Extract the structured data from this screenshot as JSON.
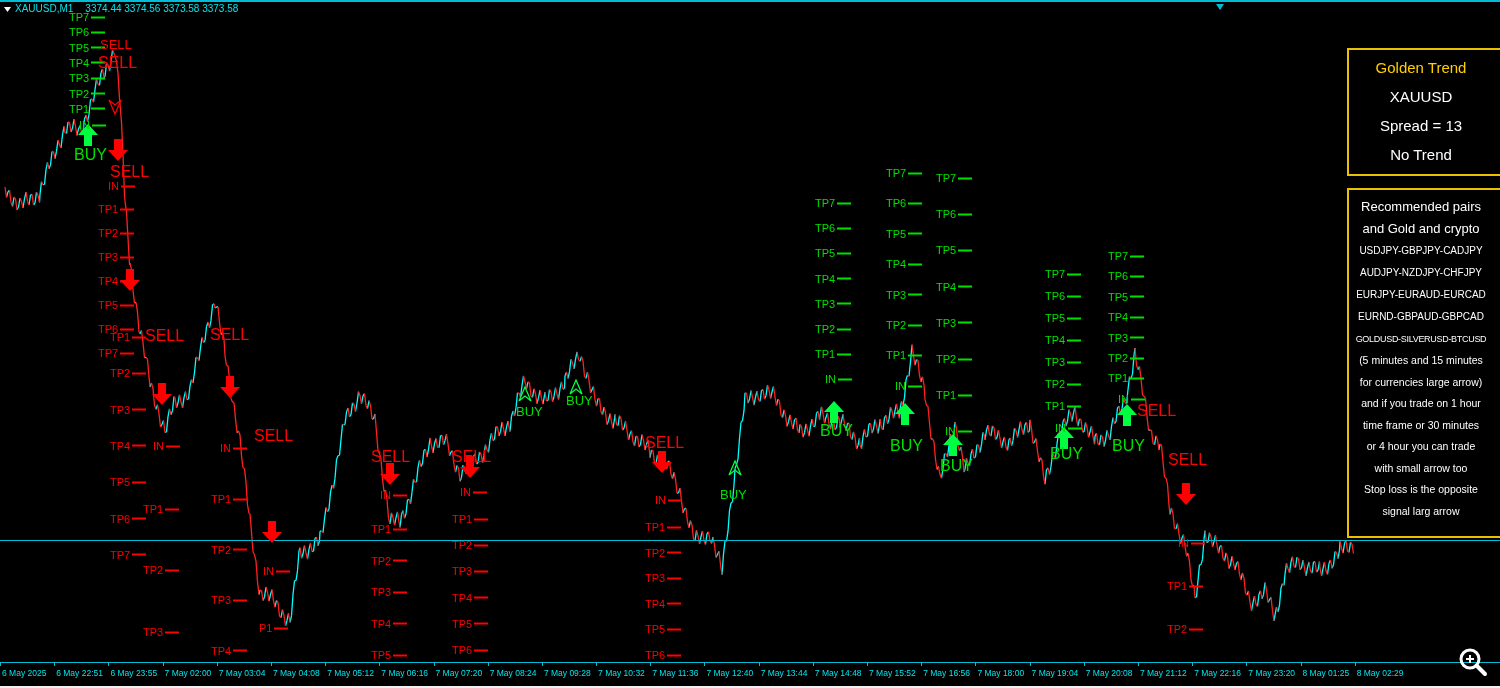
{
  "chart": {
    "symbol": "XAUUSD,M1",
    "prices": "3374.44 3374.56 3373.58 3373.58"
  },
  "labels": [
    {
      "kind": "level",
      "buy": true,
      "text": "TP7"
    },
    {
      "kind": "level",
      "buy": true,
      "text": "TP6"
    },
    {
      "kind": "level",
      "buy": true,
      "text": "TP5"
    },
    {
      "kind": "level",
      "buy": true,
      "text": "TP4"
    },
    {
      "kind": "level",
      "buy": true,
      "text": "TP3"
    },
    {
      "kind": "level",
      "buy": true,
      "text": "TP2"
    },
    {
      "kind": "level",
      "buy": true,
      "text": "TP1"
    },
    {
      "kind": "level",
      "buy": true,
      "text": "IN"
    },
    {
      "kind": "large",
      "buy": true,
      "text": "BUY"
    },
    {
      "kind": "small",
      "buy": false,
      "text": "SELL"
    },
    {
      "kind": "large",
      "buy": false,
      "text": "SELL"
    },
    {
      "kind": "large",
      "buy": false,
      "text": "SELL"
    },
    {
      "kind": "level",
      "buy": false,
      "text": "IN"
    },
    {
      "kind": "level",
      "buy": false,
      "text": "TP1"
    },
    {
      "kind": "level",
      "buy": false,
      "text": "TP2"
    },
    {
      "kind": "level",
      "buy": false,
      "text": "TP3"
    },
    {
      "kind": "level",
      "buy": false,
      "text": "TP4"
    },
    {
      "kind": "level",
      "buy": false,
      "text": "TP5"
    },
    {
      "kind": "level",
      "buy": false,
      "text": "TP6"
    },
    {
      "kind": "level",
      "buy": false,
      "text": "TP7"
    },
    {
      "kind": "level",
      "buy": false,
      "text": "TP1"
    },
    {
      "kind": "large",
      "buy": false,
      "text": "SELL"
    },
    {
      "kind": "level",
      "buy": false,
      "text": "TP2"
    },
    {
      "kind": "level",
      "buy": false,
      "text": "TP3"
    },
    {
      "kind": "level",
      "buy": false,
      "text": "TP4"
    },
    {
      "kind": "level",
      "buy": false,
      "text": "TP5"
    },
    {
      "kind": "level",
      "buy": false,
      "text": "TP6"
    },
    {
      "kind": "level",
      "buy": false,
      "text": "TP7"
    },
    {
      "kind": "large",
      "buy": false,
      "text": "SELL"
    },
    {
      "kind": "level",
      "buy": false,
      "text": "IN"
    },
    {
      "kind": "level",
      "buy": false,
      "text": "TP1"
    },
    {
      "kind": "level",
      "buy": false,
      "text": "TP2"
    },
    {
      "kind": "level",
      "buy": false,
      "text": "TP3"
    },
    {
      "kind": "level",
      "buy": false,
      "text": "IN"
    },
    {
      "kind": "large",
      "buy": false,
      "text": "SELL"
    },
    {
      "kind": "level",
      "buy": false,
      "text": "TP1"
    },
    {
      "kind": "level",
      "buy": false,
      "text": "TP2"
    },
    {
      "kind": "level",
      "buy": false,
      "text": "TP3"
    },
    {
      "kind": "level",
      "buy": false,
      "text": "TP4"
    },
    {
      "kind": "level",
      "buy": false,
      "text": "IN"
    },
    {
      "kind": "level",
      "buy": false,
      "text": "P1"
    },
    {
      "kind": "large",
      "buy": false,
      "text": "SELL"
    },
    {
      "kind": "level",
      "buy": false,
      "text": "IN"
    },
    {
      "kind": "level",
      "buy": false,
      "text": "TP1"
    },
    {
      "kind": "level",
      "buy": false,
      "text": "TP2"
    },
    {
      "kind": "level",
      "buy": false,
      "text": "TP3"
    },
    {
      "kind": "level",
      "buy": false,
      "text": "TP4"
    },
    {
      "kind": "level",
      "buy": false,
      "text": "TP5"
    },
    {
      "kind": "large",
      "buy": false,
      "text": "SELL"
    },
    {
      "kind": "level",
      "buy": false,
      "text": "IN"
    },
    {
      "kind": "level",
      "buy": false,
      "text": "TP1"
    },
    {
      "kind": "level",
      "buy": false,
      "text": "TP2"
    },
    {
      "kind": "level",
      "buy": false,
      "text": "TP3"
    },
    {
      "kind": "level",
      "buy": false,
      "text": "TP4"
    },
    {
      "kind": "level",
      "buy": false,
      "text": "TP5"
    },
    {
      "kind": "level",
      "buy": false,
      "text": "TP6"
    },
    {
      "kind": "small",
      "buy": true,
      "text": "BUY"
    },
    {
      "kind": "small",
      "buy": true,
      "text": "BUY"
    },
    {
      "kind": "large",
      "buy": false,
      "text": "SELL"
    },
    {
      "kind": "level",
      "buy": false,
      "text": "IN"
    },
    {
      "kind": "level",
      "buy": false,
      "text": "TP1"
    },
    {
      "kind": "level",
      "buy": false,
      "text": "TP2"
    },
    {
      "kind": "level",
      "buy": false,
      "text": "TP3"
    },
    {
      "kind": "level",
      "buy": false,
      "text": "TP4"
    },
    {
      "kind": "level",
      "buy": false,
      "text": "TP5"
    },
    {
      "kind": "level",
      "buy": false,
      "text": "TP6"
    },
    {
      "kind": "small",
      "buy": true,
      "text": "BUY"
    },
    {
      "kind": "level",
      "buy": true,
      "text": "TP7"
    },
    {
      "kind": "level",
      "buy": true,
      "text": "TP6"
    },
    {
      "kind": "level",
      "buy": true,
      "text": "TP5"
    },
    {
      "kind": "level",
      "buy": true,
      "text": "TP4"
    },
    {
      "kind": "level",
      "buy": true,
      "text": "TP3"
    },
    {
      "kind": "level",
      "buy": true,
      "text": "TP2"
    },
    {
      "kind": "level",
      "buy": true,
      "text": "TP1"
    },
    {
      "kind": "level",
      "buy": true,
      "text": "IN"
    },
    {
      "kind": "large",
      "buy": true,
      "text": "BUY"
    },
    {
      "kind": "level",
      "buy": true,
      "text": "TP7"
    },
    {
      "kind": "level",
      "buy": true,
      "text": "TP6"
    },
    {
      "kind": "level",
      "buy": true,
      "text": "TP5"
    },
    {
      "kind": "level",
      "buy": true,
      "text": "TP4"
    },
    {
      "kind": "level",
      "buy": true,
      "text": "TP3"
    },
    {
      "kind": "level",
      "buy": true,
      "text": "TP2"
    },
    {
      "kind": "level",
      "buy": true,
      "text": "TP1"
    },
    {
      "kind": "level",
      "buy": true,
      "text": "IN"
    },
    {
      "kind": "large",
      "buy": true,
      "text": "BUY"
    },
    {
      "kind": "level",
      "buy": true,
      "text": "TP7"
    },
    {
      "kind": "level",
      "buy": true,
      "text": "TP6"
    },
    {
      "kind": "level",
      "buy": true,
      "text": "TP5"
    },
    {
      "kind": "level",
      "buy": true,
      "text": "TP4"
    },
    {
      "kind": "level",
      "buy": true,
      "text": "TP3"
    },
    {
      "kind": "level",
      "buy": true,
      "text": "TP2"
    },
    {
      "kind": "level",
      "buy": true,
      "text": "TP1"
    },
    {
      "kind": "level",
      "buy": true,
      "text": "IN"
    },
    {
      "kind": "large",
      "buy": true,
      "text": "BUY"
    },
    {
      "kind": "level",
      "buy": true,
      "text": "TP7"
    },
    {
      "kind": "level",
      "buy": true,
      "text": "TP6"
    },
    {
      "kind": "level",
      "buy": true,
      "text": "TP5"
    },
    {
      "kind": "level",
      "buy": true,
      "text": "TP4"
    },
    {
      "kind": "level",
      "buy": true,
      "text": "TP3"
    },
    {
      "kind": "level",
      "buy": true,
      "text": "TP2"
    },
    {
      "kind": "level",
      "buy": true,
      "text": "TP1"
    },
    {
      "kind": "level",
      "buy": true,
      "text": "IN"
    },
    {
      "kind": "large",
      "buy": true,
      "text": "BUY"
    },
    {
      "kind": "level",
      "buy": true,
      "text": "TP7"
    },
    {
      "kind": "level",
      "buy": true,
      "text": "TP6"
    },
    {
      "kind": "level",
      "buy": true,
      "text": "TP5"
    },
    {
      "kind": "level",
      "buy": true,
      "text": "TP4"
    },
    {
      "kind": "level",
      "buy": true,
      "text": "TP3"
    },
    {
      "kind": "level",
      "buy": true,
      "text": "TP2"
    },
    {
      "kind": "level",
      "buy": true,
      "text": "TP1"
    },
    {
      "kind": "level",
      "buy": true,
      "text": "IN"
    },
    {
      "kind": "large",
      "buy": true,
      "text": "BUY"
    },
    {
      "kind": "large",
      "buy": false,
      "text": "SELL"
    },
    {
      "kind": "large",
      "buy": false,
      "text": "SELL"
    },
    {
      "kind": "level",
      "buy": false,
      "text": "IN"
    },
    {
      "kind": "level",
      "buy": false,
      "text": "TP1"
    },
    {
      "kind": "level",
      "buy": false,
      "text": "TP2"
    }
  ],
  "arrows": [
    {
      "kind": "large",
      "buy": true
    },
    {
      "kind": "small",
      "buy": false
    },
    {
      "kind": "large",
      "buy": false
    },
    {
      "kind": "large",
      "buy": false
    },
    {
      "kind": "large",
      "buy": false
    },
    {
      "kind": "large",
      "buy": false
    },
    {
      "kind": "large",
      "buy": false
    },
    {
      "kind": "large",
      "buy": false
    },
    {
      "kind": "large",
      "buy": false
    },
    {
      "kind": "small",
      "buy": true
    },
    {
      "kind": "small",
      "buy": true
    },
    {
      "kind": "large",
      "buy": false
    },
    {
      "kind": "small",
      "buy": true
    },
    {
      "kind": "large",
      "buy": true
    },
    {
      "kind": "large",
      "buy": true
    },
    {
      "kind": "large",
      "buy": true
    },
    {
      "kind": "large",
      "buy": true
    },
    {
      "kind": "large",
      "buy": true
    },
    {
      "kind": "large",
      "buy": false
    }
  ],
  "info_panel": {
    "title": "Golden Trend",
    "symbol": "XAUUSD",
    "spread": "Spread = 13",
    "trend": "No Trend"
  },
  "notes_panel": {
    "heading": [
      "Recommended pairs",
      "and Gold and crypto"
    ],
    "pairs": [
      "USDJPY-GBPJPY-CADJPY",
      "AUDJPY-NZDJPY-CHFJPY",
      "EURJPY-EURAUD-EURCAD",
      "EURND-GBPAUD-GBPCAD",
      "GOLDUSD-SILVERUSD-BTCUSD"
    ],
    "notes": [
      "(5 minutes and 15 minutes",
      "for currencies large arrow)",
      "and if you trade on 1 hour",
      "time frame or 30 minutes",
      "or 4 hour you can trade",
      "with small arrow too",
      "Stop loss is the opposite",
      "signal larg arrow"
    ]
  },
  "x_axis": [
    "6 May 2025",
    "6 May 22:51",
    "6 May 23:55",
    "7 May 02:00",
    "7 May 03:04",
    "7 May 04:08",
    "7 May 05:12",
    "7 May 06:16",
    "7 May 07:20",
    "7 May 08:24",
    "7 May 09:28",
    "7 May 10:32",
    "7 May 11:36",
    "7 May 12:40",
    "7 May 13:44",
    "7 May 14:48",
    "7 May 15:52",
    "7 May 16:56",
    "7 May 18:00",
    "7 May 19:04",
    "7 May 20:08",
    "7 May 21:12",
    "7 May 22:16",
    "7 May 23:20",
    "8 May 01:25",
    "8 May 02:29"
  ]
}
